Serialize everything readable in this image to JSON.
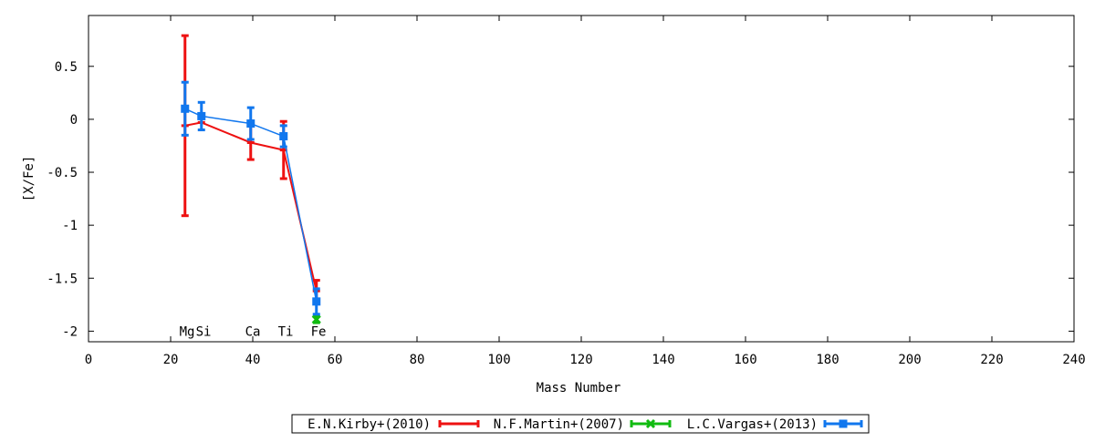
{
  "chart_data": {
    "type": "scatter",
    "xlabel": "Mass Number",
    "ylabel": "[X/Fe]",
    "xlim": [
      0,
      240
    ],
    "ylim": [
      -2.1,
      0.98
    ],
    "x_ticks": [
      0,
      20,
      40,
      60,
      80,
      100,
      120,
      140,
      160,
      180,
      200,
      220,
      240
    ],
    "y_ticks": [
      -2,
      -1.5,
      -1,
      -0.5,
      0,
      0.5
    ],
    "grid": false,
    "legend_position": "bottom-center",
    "element_labels": [
      {
        "text": "Mg",
        "x": 24
      },
      {
        "text": "Si",
        "x": 28
      },
      {
        "text": "Ca",
        "x": 40
      },
      {
        "text": "Ti",
        "x": 48
      },
      {
        "text": "Fe",
        "x": 56
      }
    ],
    "element_label_y": -2.0,
    "series": [
      {
        "name": "E.N.Kirby+(2010)",
        "color": "#ee1111",
        "marker": "bar",
        "points": [
          {
            "x": 23.5,
            "y": -0.06,
            "err": 0.85
          },
          {
            "x": 27.5,
            "y": -0.03,
            "err": 0.0
          },
          {
            "x": 39.5,
            "y": -0.22,
            "err": 0.16
          },
          {
            "x": 47.5,
            "y": -0.29,
            "err": 0.27
          },
          {
            "x": 55.5,
            "y": -1.62,
            "err": 0.1
          }
        ]
      },
      {
        "name": "N.F.Martin+(2007)",
        "color": "#11bb11",
        "marker": "x",
        "points": [
          {
            "x": 55.5,
            "y": -1.89,
            "err": 0.03
          }
        ]
      },
      {
        "name": "L.C.Vargas+(2013)",
        "color": "#1177ee",
        "marker": "square",
        "points": [
          {
            "x": 23.5,
            "y": 0.1,
            "err": 0.25
          },
          {
            "x": 27.5,
            "y": 0.03,
            "err": 0.13
          },
          {
            "x": 39.5,
            "y": -0.04,
            "err": 0.15
          },
          {
            "x": 47.5,
            "y": -0.16,
            "err": 0.1
          },
          {
            "x": 55.5,
            "y": -1.72,
            "err": 0.12
          }
        ]
      }
    ]
  }
}
